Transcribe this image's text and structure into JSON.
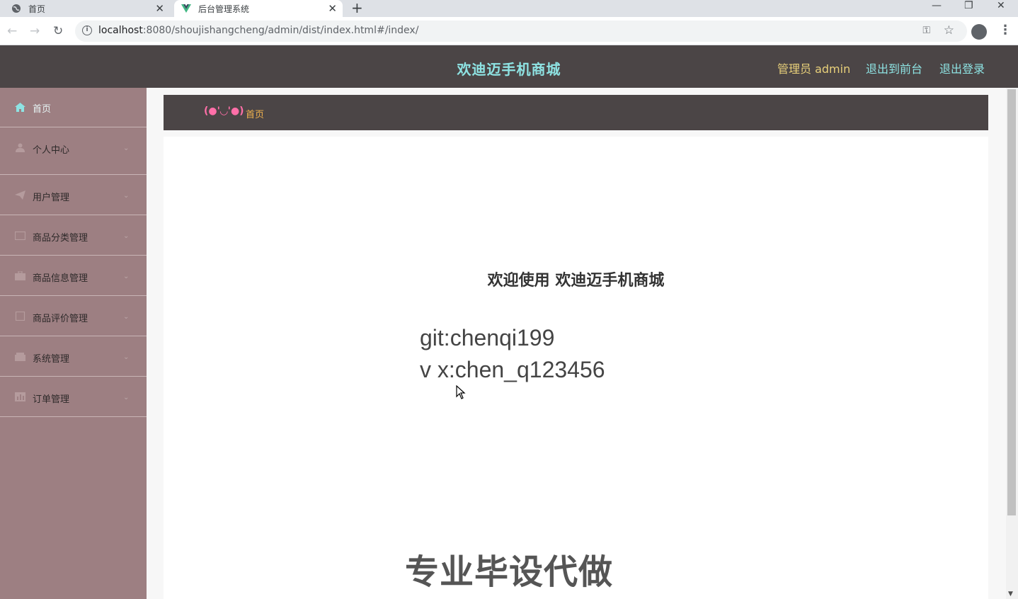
{
  "browser": {
    "tabs": [
      {
        "title": "首页",
        "icon": "globe-icon",
        "active": false
      },
      {
        "title": "后台管理系统",
        "icon": "vue-logo-icon",
        "active": true
      }
    ],
    "url_host": "localhost",
    "url_path": ":8080/shoujishangcheng/admin/dist/index.html#/index/"
  },
  "header": {
    "title": "欢迪迈手机商城",
    "admin_label": "管理员 admin",
    "to_frontend": "退出到前台",
    "logout": "退出登录"
  },
  "sidebar": {
    "items": [
      {
        "label": "首页",
        "icon": "home-icon",
        "active": true
      },
      {
        "label": "个人中心",
        "icon": "user-icon"
      },
      {
        "label": "用户管理",
        "icon": "send-icon"
      },
      {
        "label": "商品分类管理",
        "icon": "folder-icon"
      },
      {
        "label": "商品信息管理",
        "icon": "briefcase-icon"
      },
      {
        "label": "商品评价管理",
        "icon": "document-icon"
      },
      {
        "label": "系统管理",
        "icon": "box-icon"
      },
      {
        "label": "订单管理",
        "icon": "chart-icon"
      }
    ]
  },
  "breadcrumb": {
    "emoticon": "(●'◡'●)",
    "current": "首页"
  },
  "main": {
    "welcome": "欢迎使用 欢迪迈手机商城",
    "contact_git": "git:chenqi199",
    "contact_vx": "v x:chen_q123456",
    "watermark": "专业毕设代做"
  },
  "colors": {
    "header_bg": "#4b4546",
    "sidebar_bg": "#9d7f82",
    "title_accent": "#8ee3e3",
    "admin_accent": "#e8d07a",
    "crumb_accent": "#f0b24e"
  }
}
